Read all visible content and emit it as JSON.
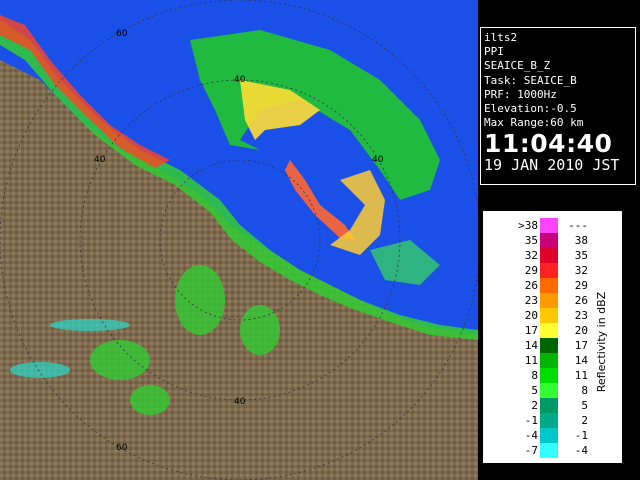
{
  "map": {
    "range_ring_labels": [
      "60",
      "40",
      "40",
      "40",
      "40",
      "60"
    ],
    "colors": {
      "sea": "#1a4fe8",
      "land": "#7d6a4f",
      "land_light": "#a58d6d",
      "rings": "#334",
      "boundaries": "#7a4a8c"
    }
  },
  "info": {
    "station": "ilts2",
    "mode": "PPI",
    "product": "SEAICE_B_Z",
    "task": "Task: SEAICE_B",
    "prf": "PRF: 1000Hz",
    "elevation": "Elevation:-0.5",
    "max_range": "Max Range:60 km",
    "time": "11:04:40",
    "date": "19 JAN 2010 JST"
  },
  "legend": {
    "title": "Reflectivity in dBZ",
    "rows": [
      {
        "left": ">38",
        "right": "---",
        "color": "#ff44ff"
      },
      {
        "left": "35",
        "right": "38",
        "color": "#c8007a"
      },
      {
        "left": "32",
        "right": "35",
        "color": "#e0002a"
      },
      {
        "left": "29",
        "right": "32",
        "color": "#ff2222"
      },
      {
        "left": "26",
        "right": "29",
        "color": "#ff6a00"
      },
      {
        "left": "23",
        "right": "26",
        "color": "#ff9900"
      },
      {
        "left": "20",
        "right": "23",
        "color": "#ffc800"
      },
      {
        "left": "17",
        "right": "20",
        "color": "#ffff33"
      },
      {
        "left": "14",
        "right": "17",
        "color": "#006400"
      },
      {
        "left": "11",
        "right": "14",
        "color": "#00b400"
      },
      {
        "left": "8",
        "right": "11",
        "color": "#00dd00"
      },
      {
        "left": "5",
        "right": "8",
        "color": "#33ff33"
      },
      {
        "left": "2",
        "right": "5",
        "color": "#009966"
      },
      {
        "left": "-1",
        "right": "2",
        "color": "#00aa88"
      },
      {
        "left": "-4",
        "right": "-1",
        "color": "#00c8c8"
      },
      {
        "left": "-7",
        "right": "-4",
        "color": "#33ffff"
      }
    ]
  }
}
